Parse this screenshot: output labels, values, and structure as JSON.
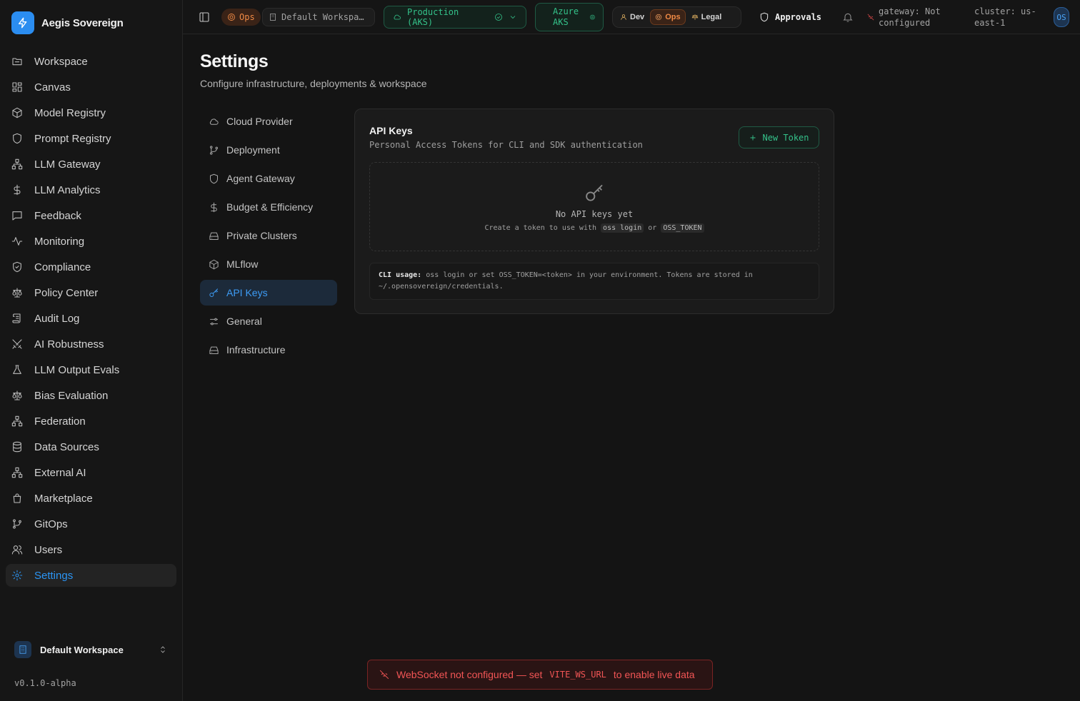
{
  "app": {
    "name": "Aegis Sovereign",
    "version": "v0.1.0-alpha"
  },
  "sidebar": {
    "items": [
      {
        "label": "Workspace",
        "icon": "folder-icon"
      },
      {
        "label": "Canvas",
        "icon": "grid-icon"
      },
      {
        "label": "Model Registry",
        "icon": "box-icon"
      },
      {
        "label": "Prompt Registry",
        "icon": "shield-icon"
      },
      {
        "label": "LLM Gateway",
        "icon": "network-icon"
      },
      {
        "label": "LLM Analytics",
        "icon": "dollar-icon"
      },
      {
        "label": "Feedback",
        "icon": "message-icon"
      },
      {
        "label": "Monitoring",
        "icon": "activity-icon"
      },
      {
        "label": "Compliance",
        "icon": "shield-check-icon"
      },
      {
        "label": "Policy Center",
        "icon": "scale-icon"
      },
      {
        "label": "Audit Log",
        "icon": "scroll-icon"
      },
      {
        "label": "AI Robustness",
        "icon": "swords-icon"
      },
      {
        "label": "LLM Output Evals",
        "icon": "flask-icon"
      },
      {
        "label": "Bias Evaluation",
        "icon": "scale-icon"
      },
      {
        "label": "Federation",
        "icon": "network-icon"
      },
      {
        "label": "Data Sources",
        "icon": "database-icon"
      },
      {
        "label": "External AI",
        "icon": "network-icon"
      },
      {
        "label": "Marketplace",
        "icon": "store-icon"
      },
      {
        "label": "GitOps",
        "icon": "git-branch-icon"
      },
      {
        "label": "Users",
        "icon": "users-icon"
      },
      {
        "label": "Settings",
        "icon": "gear-icon",
        "active": true
      }
    ],
    "workspace": "Default Workspace"
  },
  "topbar": {
    "role_badge": "Ops",
    "workspace_pill": "Default Workspa…",
    "environment": "Production (AKS)",
    "cloud_line1": "Azure",
    "cloud_line2": "AKS",
    "personas": [
      "Dev",
      "Ops",
      "Legal"
    ],
    "active_persona": "Ops",
    "approvals": "Approvals",
    "gateway_status": "gateway: Not configured",
    "cluster_status": "cluster: us-east-1",
    "avatar": "OS"
  },
  "page": {
    "title": "Settings",
    "subtitle": "Configure infrastructure, deployments & workspace"
  },
  "settings_nav": [
    {
      "label": "Cloud Provider",
      "icon": "cloud-icon"
    },
    {
      "label": "Deployment",
      "icon": "git-branch-icon"
    },
    {
      "label": "Agent Gateway",
      "icon": "shield-icon"
    },
    {
      "label": "Budget & Efficiency",
      "icon": "dollar-icon"
    },
    {
      "label": "Private Clusters",
      "icon": "hard-drive-icon"
    },
    {
      "label": "MLflow",
      "icon": "box-icon"
    },
    {
      "label": "API Keys",
      "icon": "key-icon",
      "active": true
    },
    {
      "label": "General",
      "icon": "sliders-icon"
    },
    {
      "label": "Infrastructure",
      "icon": "hard-drive-icon"
    }
  ],
  "api_keys": {
    "title": "API Keys",
    "description": "Personal Access Tokens for CLI and SDK authentication",
    "new_token": "New Token",
    "empty_title": "No API keys yet",
    "empty_hint_prefix": "Create a token to use with",
    "empty_hint_cmd": "oss login",
    "empty_hint_or": "or",
    "empty_hint_env": "OSS_TOKEN",
    "cli_label": "CLI usage:",
    "cli_text": "oss login or set OSS_TOKEN=<token> in your environment. Tokens are stored in ~/.opensovereign/credentials."
  },
  "toast": {
    "prefix": "WebSocket not configured — set",
    "var": "VITE_WS_URL",
    "suffix": "to enable live data"
  },
  "colors": {
    "accent_blue": "#2b95f5",
    "accent_green": "#34c28a",
    "accent_orange": "#f08a45",
    "error_red": "#f25555"
  }
}
